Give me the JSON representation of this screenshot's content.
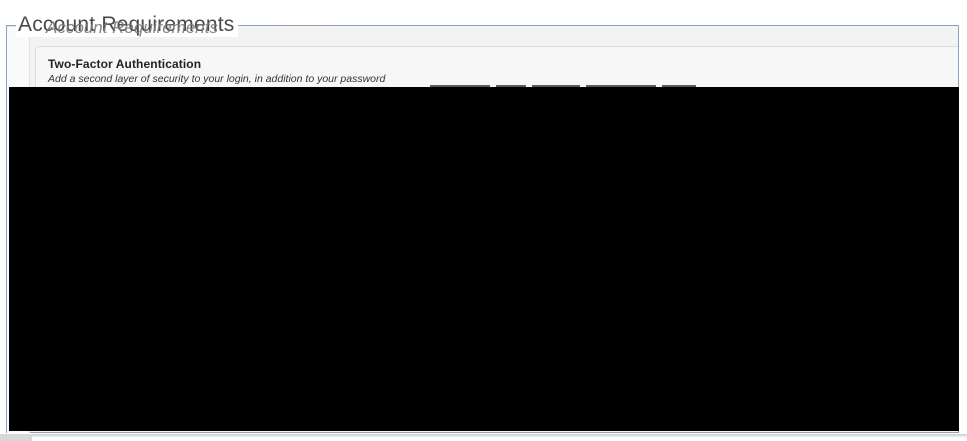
{
  "page": {
    "title": "Account Requirements"
  },
  "two_factor": {
    "title": "Two-Factor Authentication",
    "description": "Add a second layer of security to your login, in addition to your password"
  },
  "colors": {
    "frame_border": "#8aa2be",
    "panel_background": "#f7f7f7",
    "redaction": "#000000"
  }
}
